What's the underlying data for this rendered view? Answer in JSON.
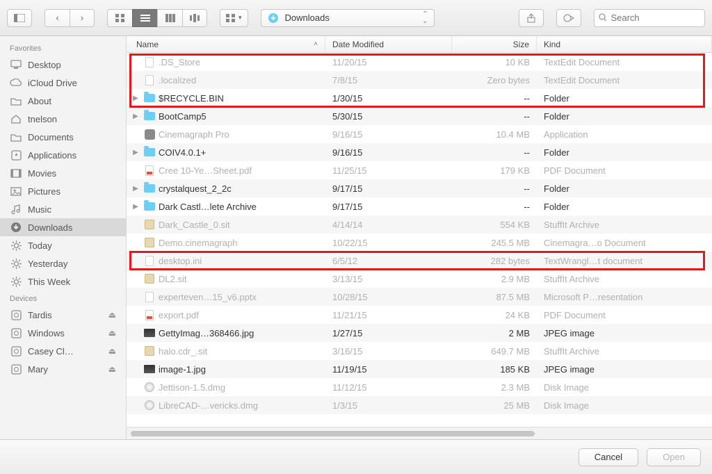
{
  "toolbar": {
    "current_folder": "Downloads",
    "search_placeholder": "Search"
  },
  "sidebar": {
    "sections": [
      {
        "label": "Favorites",
        "items": [
          {
            "icon": "desktop",
            "label": "Desktop"
          },
          {
            "icon": "cloud",
            "label": "iCloud Drive"
          },
          {
            "icon": "folder",
            "label": "About"
          },
          {
            "icon": "home",
            "label": "tnelson"
          },
          {
            "icon": "folder",
            "label": "Documents"
          },
          {
            "icon": "app",
            "label": "Applications"
          },
          {
            "icon": "movie",
            "label": "Movies"
          },
          {
            "icon": "picture",
            "label": "Pictures"
          },
          {
            "icon": "music",
            "label": "Music"
          },
          {
            "icon": "downloads",
            "label": "Downloads",
            "selected": true
          },
          {
            "icon": "gear",
            "label": "Today"
          },
          {
            "icon": "gear",
            "label": "Yesterday"
          },
          {
            "icon": "gear",
            "label": "This Week"
          }
        ]
      },
      {
        "label": "Devices",
        "items": [
          {
            "icon": "disk",
            "label": "Tardis",
            "eject": true
          },
          {
            "icon": "disk",
            "label": "Windows",
            "eject": true
          },
          {
            "icon": "disk",
            "label": "Casey Cl…",
            "eject": true
          },
          {
            "icon": "disk",
            "label": "Mary",
            "eject": true
          }
        ]
      }
    ]
  },
  "columns": {
    "name": "Name",
    "date": "Date Modified",
    "size": "Size",
    "kind": "Kind"
  },
  "files": [
    {
      "dim": true,
      "name": ".DS_Store",
      "date": "11/20/15",
      "size": "10 KB",
      "kind": "TextEdit Document",
      "icon": "doc"
    },
    {
      "dim": true,
      "name": ".localized",
      "date": "7/8/15",
      "size": "Zero bytes",
      "kind": "TextEdit Document",
      "icon": "doc"
    },
    {
      "dim": false,
      "expand": true,
      "name": "$RECYCLE.BIN",
      "date": "1/30/15",
      "size": "--",
      "kind": "Folder",
      "icon": "folder"
    },
    {
      "dim": false,
      "expand": true,
      "name": "BootCamp5",
      "date": "5/30/15",
      "size": "--",
      "kind": "Folder",
      "icon": "folder"
    },
    {
      "dim": true,
      "name": "Cinemagraph Pro",
      "date": "9/16/15",
      "size": "10.4 MB",
      "kind": "Application",
      "icon": "app"
    },
    {
      "dim": false,
      "expand": true,
      "name": "COIV4.0.1+",
      "date": "9/16/15",
      "size": "--",
      "kind": "Folder",
      "icon": "folder"
    },
    {
      "dim": true,
      "name": "Cree 10-Ye…Sheet.pdf",
      "date": "11/25/15",
      "size": "179 KB",
      "kind": "PDF Document",
      "icon": "pdf"
    },
    {
      "dim": false,
      "expand": true,
      "name": "crystalquest_2_2c",
      "date": "9/17/15",
      "size": "--",
      "kind": "Folder",
      "icon": "folder"
    },
    {
      "dim": false,
      "expand": true,
      "name": "Dark Castl…lete Archive",
      "date": "9/17/15",
      "size": "--",
      "kind": "Folder",
      "icon": "folder"
    },
    {
      "dim": true,
      "name": "Dark_Castle_0.sit",
      "date": "4/14/14",
      "size": "554 KB",
      "kind": "StuffIt Archive",
      "icon": "archive"
    },
    {
      "dim": true,
      "name": "Demo.cinemagraph",
      "date": "10/22/15",
      "size": "245.5 MB",
      "kind": "Cinemagra…o Document",
      "icon": "archive"
    },
    {
      "dim": true,
      "name": "desktop.ini",
      "date": "6/5/12",
      "size": "282 bytes",
      "kind": "TextWrangl…t document",
      "icon": "doc"
    },
    {
      "dim": true,
      "name": "DL2.sit",
      "date": "3/13/15",
      "size": "2.9 MB",
      "kind": "StuffIt Archive",
      "icon": "archive"
    },
    {
      "dim": true,
      "name": "experteven…15_v6.pptx",
      "date": "10/28/15",
      "size": "87.5 MB",
      "kind": "Microsoft P…resentation",
      "icon": "doc"
    },
    {
      "dim": true,
      "name": "export.pdf",
      "date": "11/21/15",
      "size": "24 KB",
      "kind": "PDF Document",
      "icon": "pdf"
    },
    {
      "dim": false,
      "name": "GettyImag…368466.jpg",
      "date": "1/27/15",
      "size": "2 MB",
      "kind": "JPEG image",
      "icon": "img"
    },
    {
      "dim": true,
      "name": "halo.cdr_.sit",
      "date": "3/16/15",
      "size": "649.7 MB",
      "kind": "StuffIt Archive",
      "icon": "archive"
    },
    {
      "dim": false,
      "name": "image-1.jpg",
      "date": "11/19/15",
      "size": "185 KB",
      "kind": "JPEG image",
      "icon": "img"
    },
    {
      "dim": true,
      "name": "Jettison-1.5.dmg",
      "date": "11/12/15",
      "size": "2.3 MB",
      "kind": "Disk Image",
      "icon": "dmg"
    },
    {
      "dim": true,
      "name": "LibreCAD-…vericks.dmg",
      "date": "1/3/15",
      "size": "25 MB",
      "kind": "Disk Image",
      "icon": "dmg"
    }
  ],
  "footer": {
    "cancel": "Cancel",
    "open": "Open"
  }
}
